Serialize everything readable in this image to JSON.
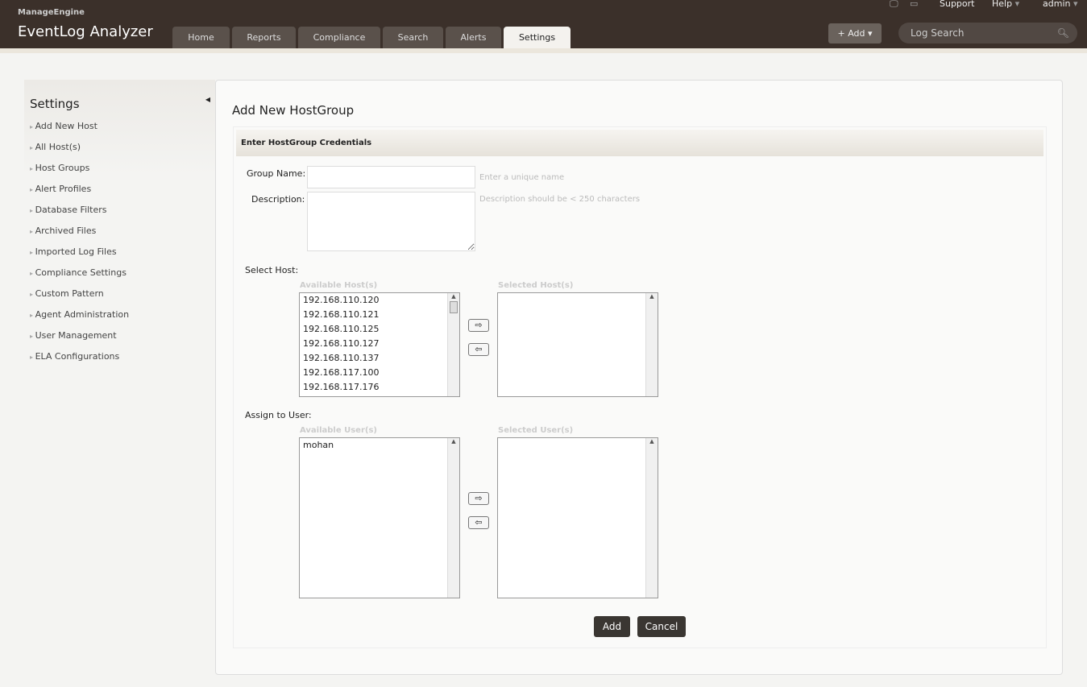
{
  "header": {
    "brand": "ManageEngine",
    "product": "EventLog Analyzer",
    "tabs": [
      "Home",
      "Reports",
      "Compliance",
      "Search",
      "Alerts",
      "Settings"
    ],
    "active_tab": "Settings",
    "support": "Support",
    "help": "Help",
    "user": "admin",
    "add": "+ Add ▾",
    "search_placeholder": "Log Search"
  },
  "sidebar": {
    "title": "Settings",
    "items": [
      "Add New Host",
      "All Host(s)",
      "Host Groups",
      "Alert Profiles",
      "Database Filters",
      "Archived Files",
      "Imported Log Files",
      "Compliance Settings",
      "Custom Pattern",
      "Agent Administration",
      "User Management",
      "ELA Configurations"
    ]
  },
  "form": {
    "title": "Add New HostGroup",
    "section": "Enter HostGroup Credentials",
    "group_name_label": "Group Name:",
    "group_name_value": "",
    "group_name_hint": "Enter a unique name",
    "description_label": "Description:",
    "description_value": "",
    "description_hint": "Description should be < 250 characters",
    "select_host_label": "Select Host:",
    "available_hosts_label": "Available Host(s)",
    "selected_hosts_label": "Selected Host(s)",
    "available_hosts": [
      "192.168.110.120",
      "192.168.110.121",
      "192.168.110.125",
      "192.168.110.127",
      "192.168.110.137",
      "192.168.117.100",
      "192.168.117.176"
    ],
    "assign_user_label": "Assign to User:",
    "available_users_label": "Available User(s)",
    "selected_users_label": "Selected User(s)",
    "available_users": [
      "mohan"
    ],
    "add_button": "Add",
    "cancel_button": "Cancel"
  }
}
